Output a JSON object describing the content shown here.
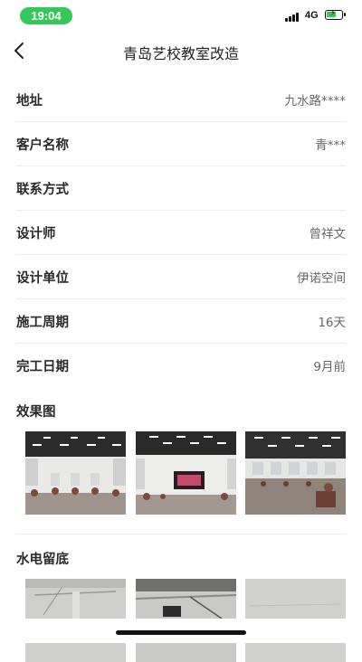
{
  "status": {
    "time": "19:04",
    "network": "4G"
  },
  "header": {
    "title": "青岛艺校教室改造"
  },
  "details": [
    {
      "label": "地址",
      "value": "九水路****"
    },
    {
      "label": "客户名称",
      "value": "青***"
    },
    {
      "label": "联系方式",
      "value": ""
    },
    {
      "label": "设计师",
      "value": "曾祥文"
    },
    {
      "label": "设计单位",
      "value": "伊诺空间"
    },
    {
      "label": "施工周期",
      "value": "16天"
    },
    {
      "label": "完工日期",
      "value": "9月前"
    }
  ],
  "sections": {
    "renderings_title": "效果图",
    "plumbing_title": "水电留底"
  },
  "colors": {
    "status_green": "#35c759",
    "divider": "#ededed"
  }
}
